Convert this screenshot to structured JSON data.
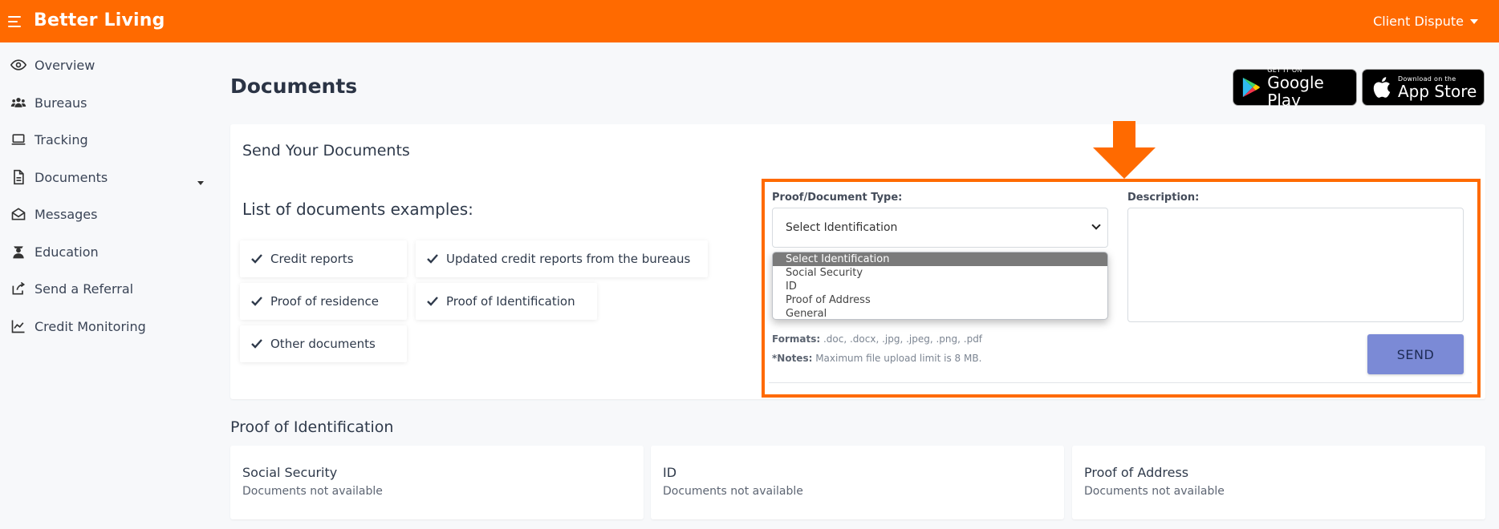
{
  "app": {
    "brand": "Better Living",
    "user_menu": "Client Dispute",
    "accent_color": "#ff6a00"
  },
  "sidebar": {
    "items": [
      {
        "label": "Overview",
        "icon": "eye-icon"
      },
      {
        "label": "Bureaus",
        "icon": "users-icon"
      },
      {
        "label": "Tracking",
        "icon": "laptop-icon"
      },
      {
        "label": "Documents",
        "icon": "document-icon"
      },
      {
        "label": "Messages",
        "icon": "envelope-open-icon"
      },
      {
        "label": "Education",
        "icon": "graduate-icon"
      },
      {
        "label": "Send a Referral",
        "icon": "share-icon"
      },
      {
        "label": "Credit Monitoring",
        "icon": "chart-line-icon"
      }
    ]
  },
  "main": {
    "title": "Documents",
    "stores": {
      "google": {
        "small": "GET IT ON",
        "big": "Google Play"
      },
      "apple": {
        "small": "Download on the",
        "big": "App Store"
      }
    },
    "send_card": {
      "title": "Send Your Documents",
      "list_title": "List of documents examples:",
      "examples": [
        "Credit reports",
        "Updated credit reports from the bureaus",
        "Proof of residence",
        "Proof of Identification",
        "Other documents"
      ],
      "form": {
        "type_label": "Proof/Document Type:",
        "selected": "Select Identification",
        "options": [
          "Select Identification",
          "Social Security",
          "ID",
          "Proof of Address",
          "General"
        ],
        "description_label": "Description:",
        "formats_label": "Formats:",
        "formats_value": " .doc, .docx, .jpg, .jpeg, .png, .pdf",
        "notes_label": "*Notes:",
        "notes_value": " Maximum file upload limit is 8 MB.",
        "send_label": "SEND"
      }
    },
    "proof_section": {
      "title": "Proof of Identification",
      "cards": [
        {
          "title": "Social Security",
          "status": "Documents not available"
        },
        {
          "title": "ID",
          "status": "Documents not available"
        },
        {
          "title": "Proof of Address",
          "status": "Documents not available"
        }
      ]
    }
  }
}
